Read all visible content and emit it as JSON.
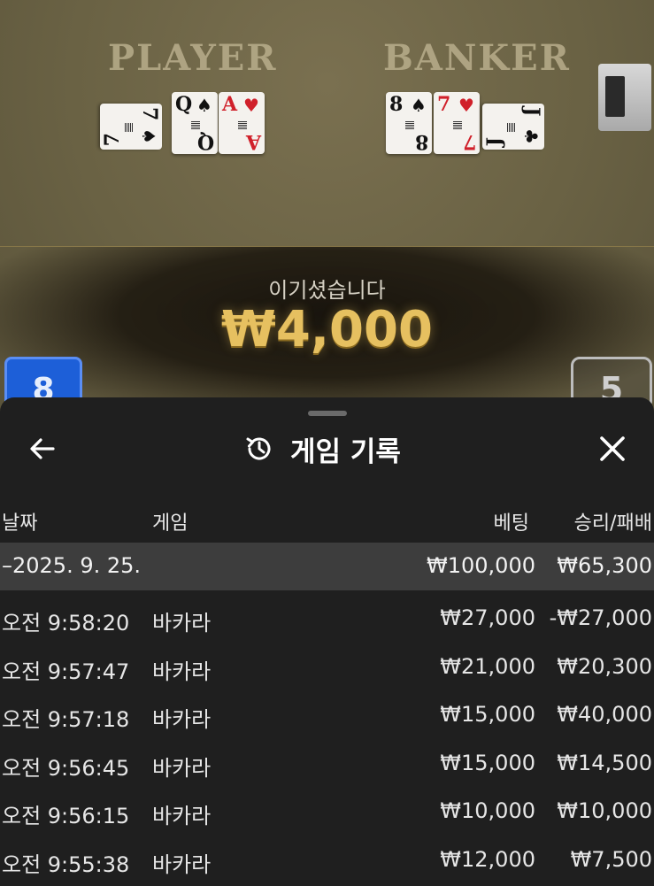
{
  "table": {
    "player_label": "PLAYER",
    "banker_label": "BANKER",
    "player_cards": [
      {
        "rank": "7",
        "suit": "♠",
        "color": "black"
      },
      {
        "rank": "Q",
        "suit": "♠",
        "color": "black"
      },
      {
        "rank": "A",
        "suit": "♥",
        "color": "red"
      }
    ],
    "banker_cards": [
      {
        "rank": "8",
        "suit": "♠",
        "color": "black"
      },
      {
        "rank": "7",
        "suit": "♥",
        "color": "red"
      },
      {
        "rank": "J",
        "suit": "♣",
        "color": "black"
      }
    ],
    "win_message": "이기셨습니다",
    "win_amount": "₩4,000",
    "player_score": "8",
    "banker_score": "5"
  },
  "sheet": {
    "title": "게임 기록",
    "back_icon": "arrow-left-icon",
    "history_icon": "history-icon",
    "close_icon": "close-icon",
    "columns": {
      "date": "날짜",
      "game": "게임",
      "bet": "베팅",
      "result": "승리/패배"
    },
    "group": {
      "date": "–2025. 9. 25.",
      "bet_total": "₩100,000",
      "result_total": "₩65,300"
    },
    "rows": [
      {
        "time": "오전 9:58:20",
        "game": "바카라",
        "bet": "₩27,000",
        "result": "-₩27,000"
      },
      {
        "time": "오전 9:57:47",
        "game": "바카라",
        "bet": "₩21,000",
        "result": "₩20,300"
      },
      {
        "time": "오전 9:57:18",
        "game": "바카라",
        "bet": "₩15,000",
        "result": "₩40,000"
      },
      {
        "time": "오전 9:56:45",
        "game": "바카라",
        "bet": "₩15,000",
        "result": "₩14,500"
      },
      {
        "time": "오전 9:56:15",
        "game": "바카라",
        "bet": "₩10,000",
        "result": "₩10,000"
      },
      {
        "time": "오전 9:55:38",
        "game": "바카라",
        "bet": "₩12,000",
        "result": "₩7,500"
      }
    ]
  },
  "colors": {
    "sheet_bg": "#1f1f1f",
    "group_row_bg": "#3d3d3d",
    "win_gold": "#e6c060",
    "player_blue": "#1d5fd8"
  }
}
